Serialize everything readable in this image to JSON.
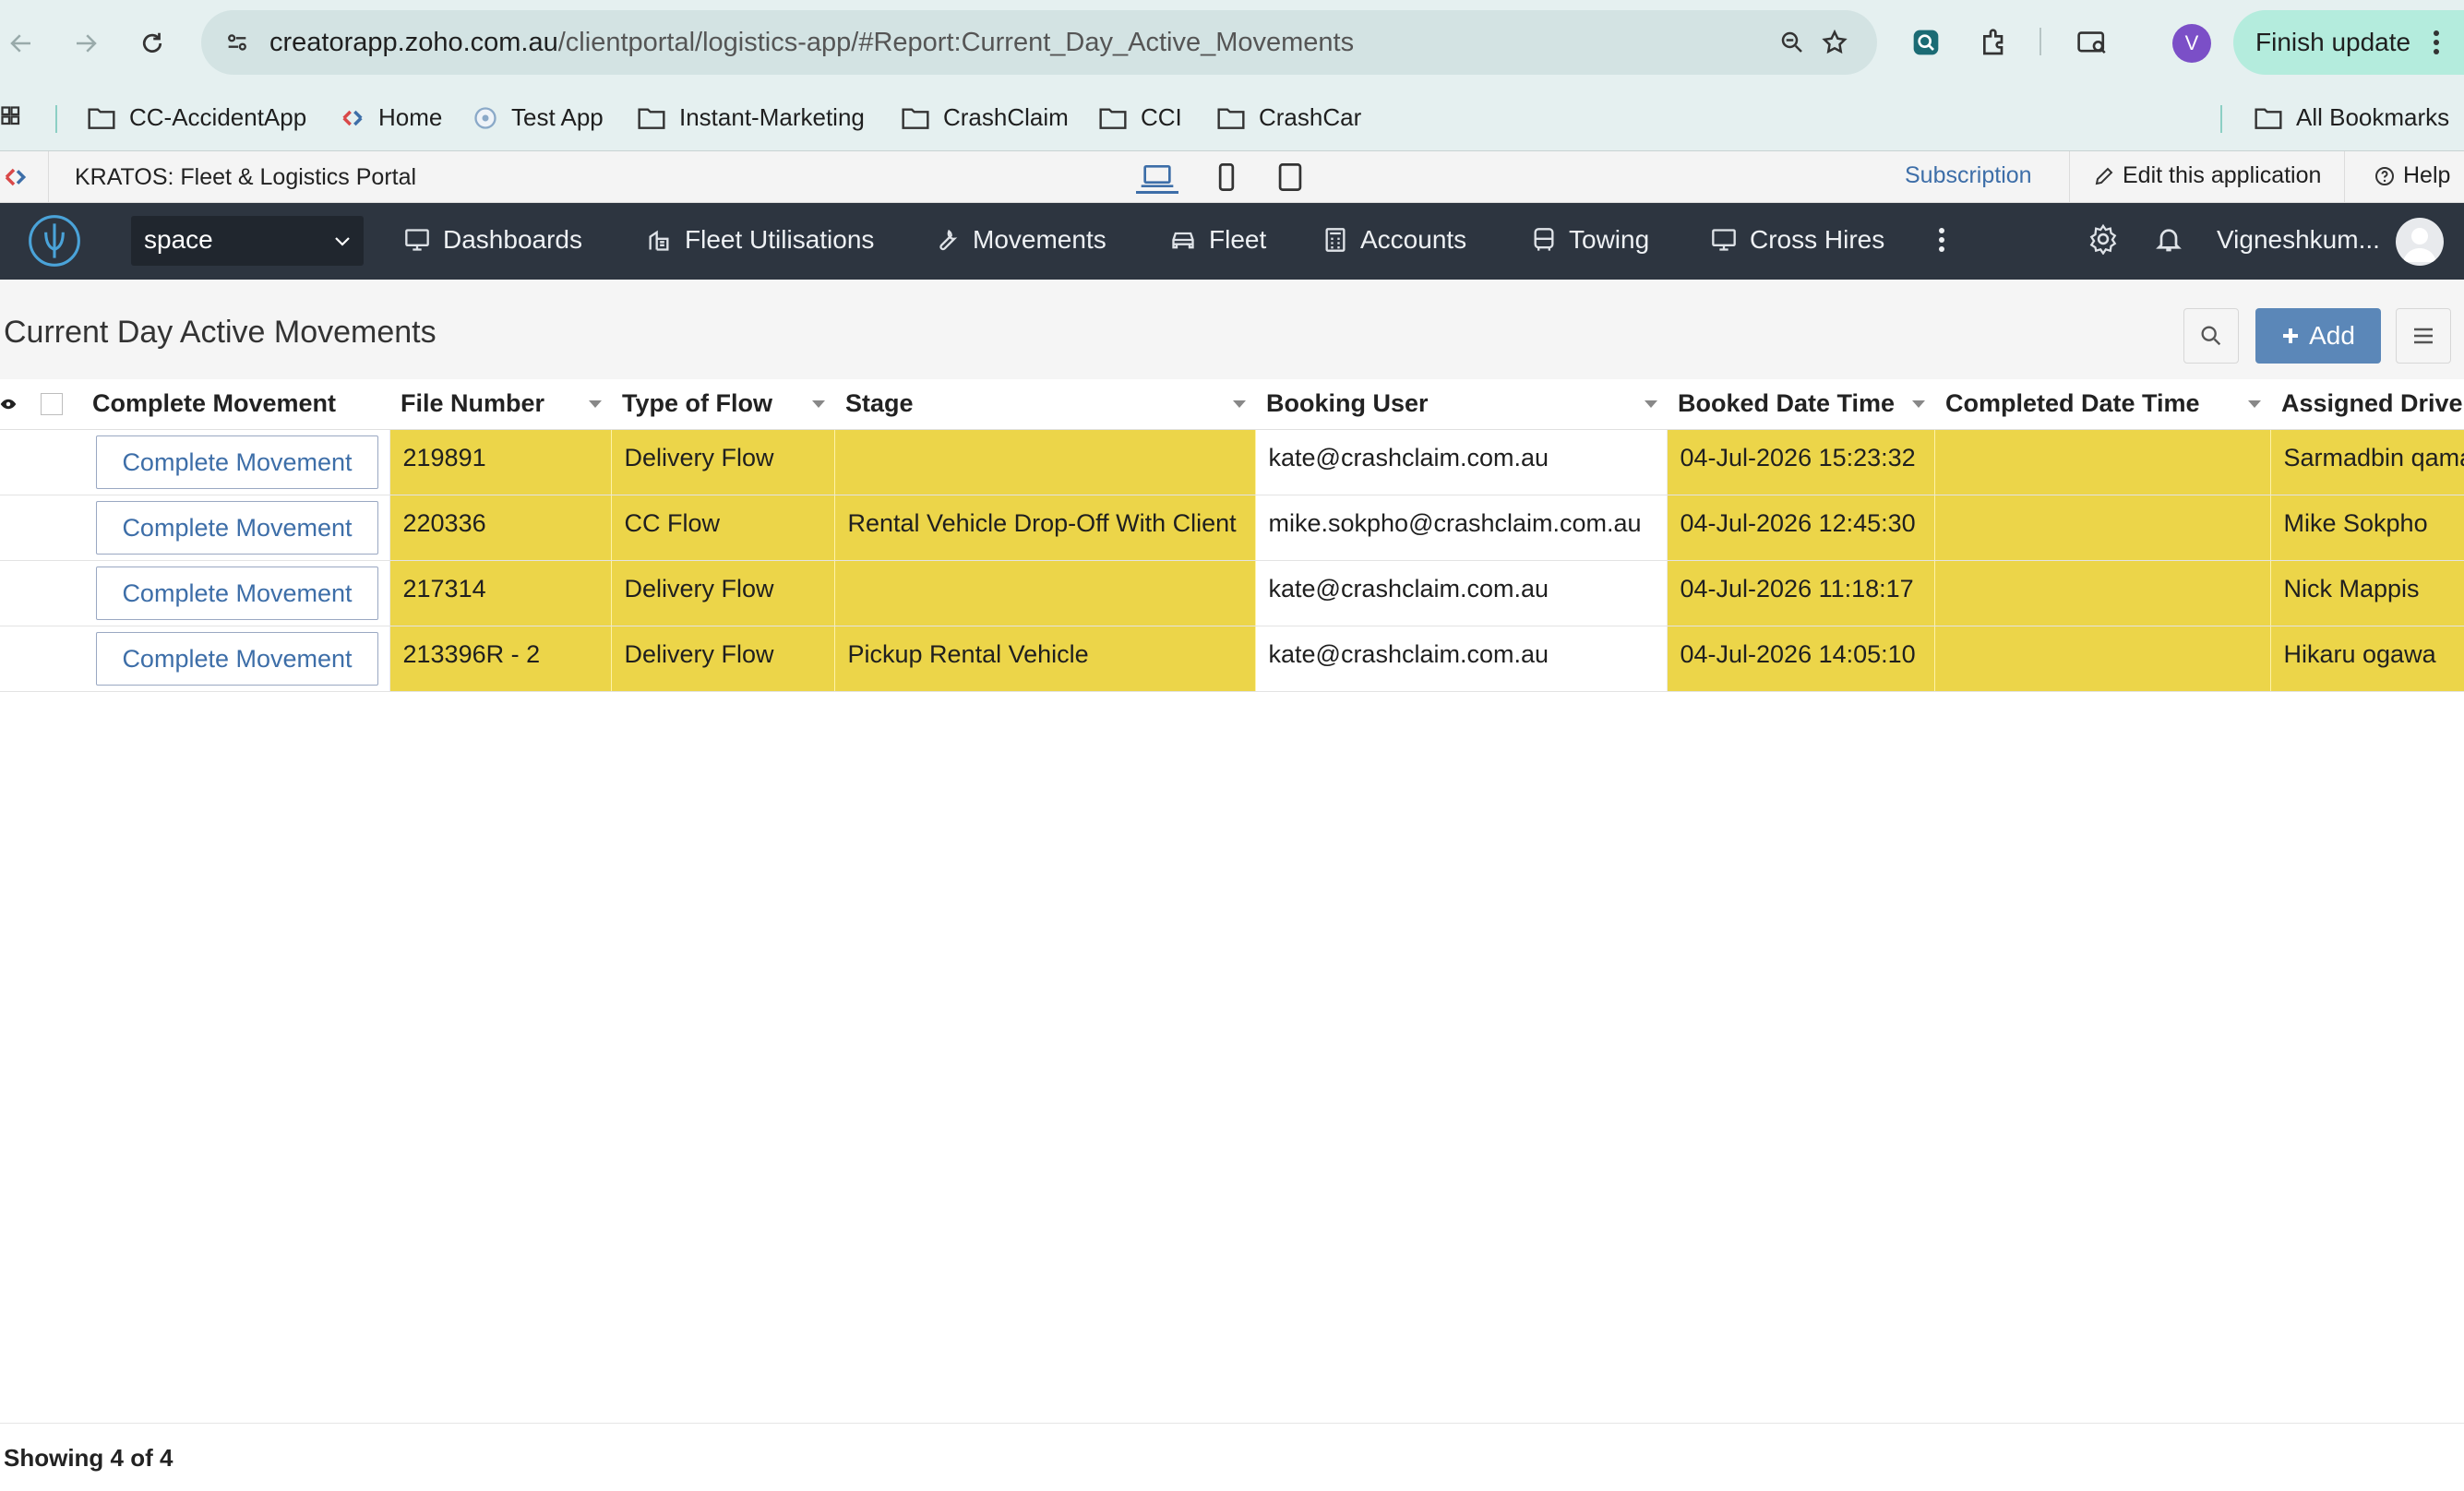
{
  "browser": {
    "url_host": "creatorapp.zoho.com.au",
    "url_path": "/clientportal/logistics-app/#Report:Current_Day_Active_Movements",
    "profile_initial": "V",
    "finish_update_label": "Finish update"
  },
  "bookmarks": {
    "items": [
      {
        "label": "CC-AccidentApp",
        "icon": "folder-icon"
      },
      {
        "label": "Home",
        "icon": "zoho-icon"
      },
      {
        "label": "Test App",
        "icon": "app-icon"
      },
      {
        "label": "Instant-Marketing",
        "icon": "folder-icon"
      },
      {
        "label": "CrashClaim",
        "icon": "folder-icon"
      },
      {
        "label": "CCI",
        "icon": "folder-icon"
      },
      {
        "label": "CrashCar",
        "icon": "folder-icon"
      }
    ],
    "all_bookmarks_label": "All Bookmarks"
  },
  "appbar": {
    "title": "KRATOS: Fleet & Logistics Portal",
    "subscription_label": "Subscription",
    "edit_label": "Edit this application",
    "help_label": "Help"
  },
  "nav": {
    "space_value": "space",
    "items": [
      "Dashboards",
      "Fleet Utilisations",
      "Movements",
      "Fleet",
      "Accounts",
      "Towing",
      "Cross Hires"
    ],
    "user_name": "Vigneshkum..."
  },
  "report": {
    "title": "Current Day Active Movements",
    "add_label": "Add"
  },
  "table": {
    "columns": [
      "Complete Movement",
      "File Number",
      "Type of Flow",
      "Stage",
      "Booking User",
      "Booked Date Time",
      "Completed Date Time",
      "Assigned Driver"
    ],
    "rows": [
      {
        "action": "Complete Movement",
        "file_number": "219891",
        "flow": "Delivery Flow",
        "stage": "",
        "user": "kate@crashclaim.com.au",
        "booked": "04-Jul-2026 15:23:32",
        "completed": "",
        "driver": "Sarmadbin qamar"
      },
      {
        "action": "Complete Movement",
        "file_number": "220336",
        "flow": "CC Flow",
        "stage": "Rental Vehicle Drop-Off With Client",
        "user": "mike.sokpho@crashclaim.com.au",
        "booked": "04-Jul-2026 12:45:30",
        "completed": "",
        "driver": "Mike Sokpho"
      },
      {
        "action": "Complete Movement",
        "file_number": "217314",
        "flow": "Delivery Flow",
        "stage": "",
        "user": "kate@crashclaim.com.au",
        "booked": "04-Jul-2026 11:18:17",
        "completed": "",
        "driver": "Nick Mappis"
      },
      {
        "action": "Complete Movement",
        "file_number": "213396R - 2",
        "flow": "Delivery Flow",
        "stage": "Pickup Rental Vehicle",
        "user": "kate@crashclaim.com.au",
        "booked": "04-Jul-2026 14:05:10",
        "completed": "",
        "driver": "Hikaru ogawa"
      }
    ]
  },
  "footer": {
    "showing": "Showing 4 of 4"
  },
  "colors": {
    "highlight": "#ecd549",
    "nav_bg": "#2d3540",
    "accent": "#5b87b8"
  }
}
